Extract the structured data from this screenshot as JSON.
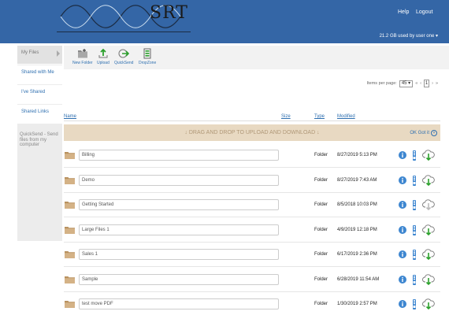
{
  "header": {
    "logo_text": "SRT",
    "help_label": "Help",
    "logout_label": "Logout",
    "usage_text": "21.2 GB used by  user one",
    "usage_caret": "▾"
  },
  "sidebar": {
    "items": [
      {
        "label": "My Files",
        "active": true
      },
      {
        "label": "Shared with Me",
        "active": false
      },
      {
        "label": "I've Shared",
        "active": false
      },
      {
        "label": "Shared Links",
        "active": false
      }
    ],
    "quicksend_note": "QuickSend - Send files from my computer"
  },
  "toolbar": {
    "new_folder_label": "New Folder",
    "upload_label": "Upload",
    "quicksend_label": "QuickSend",
    "dropzone_label": "DropZone"
  },
  "pager": {
    "label": "Items per page:",
    "per_page": "45",
    "per_page_caret": "▾",
    "first": "«",
    "prev": "‹",
    "page": "1",
    "next": "›",
    "last": "»"
  },
  "columns": {
    "name": "Name",
    "size": "Size",
    "type": "Type",
    "modified": "Modified"
  },
  "dropzone": {
    "text": "↓ DRAG AND DROP TO UPLOAD AND DOWNLOAD ↓",
    "gotit": "OK Got it",
    "close": "×"
  },
  "files": [
    {
      "name": "Billing",
      "type": "Folder",
      "modified": "8/27/2019 5:13 PM",
      "download_disabled": false
    },
    {
      "name": "Demo",
      "type": "Folder",
      "modified": "8/27/2019 7:43 AM",
      "download_disabled": false
    },
    {
      "name": "Getting Started",
      "type": "Folder",
      "modified": "8/5/2018 10:03 PM",
      "download_disabled": true
    },
    {
      "name": "Large Files 1",
      "type": "Folder",
      "modified": "4/9/2019 12:18 PM",
      "download_disabled": false
    },
    {
      "name": "Sales 1",
      "type": "Folder",
      "modified": "6/17/2019 2:36 PM",
      "download_disabled": false
    },
    {
      "name": "Sample",
      "type": "Folder",
      "modified": "6/28/2019 11:54 AM",
      "download_disabled": false
    },
    {
      "name": "test move PDF",
      "type": "Folder",
      "modified": "1/30/2019 2:57 PM",
      "download_disabled": false
    }
  ],
  "colors": {
    "header_bg": "#3466a6",
    "link": "#2e6fb0",
    "dropzone_bg": "#e8d9c2",
    "folder": "#c9a77c"
  }
}
